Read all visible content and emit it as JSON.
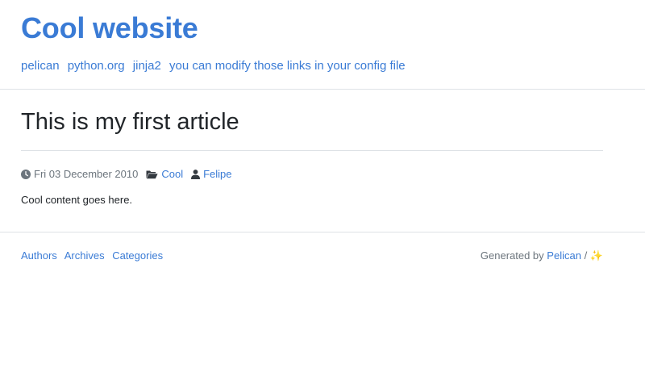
{
  "header": {
    "site_title": "Cool website",
    "links": [
      {
        "label": "pelican"
      },
      {
        "label": "python.org"
      },
      {
        "label": "jinja2"
      },
      {
        "label": "you can modify those links in your config file"
      }
    ]
  },
  "article": {
    "title": "This is my first article",
    "date": "Fri 03 December 2010",
    "category": "Cool",
    "author": "Felipe",
    "body": "Cool content goes here.",
    "icons": [
      "clock-icon",
      "folder-open-icon",
      "user-icon"
    ]
  },
  "footer": {
    "links": [
      {
        "label": "Authors"
      },
      {
        "label": "Archives"
      },
      {
        "label": "Categories"
      }
    ],
    "generated_prefix": "Generated by",
    "generator": "Pelican",
    "separator": "/",
    "sparkle": "✨"
  },
  "colors": {
    "link": "#3a7bd5",
    "text": "#212529",
    "muted": "#6c757d",
    "rule": "#dee2e6"
  }
}
